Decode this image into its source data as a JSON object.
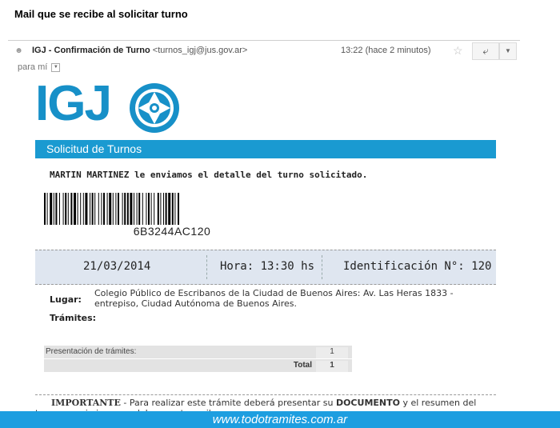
{
  "page": {
    "heading": "Mail que se recibe al solicitar turno"
  },
  "email": {
    "sender_name": "IGJ - Confirmación de Turno",
    "sender_email": "<turnos_igj@jus.gov.ar>",
    "time": "13:22 (hace 2 minutos)",
    "recipient": "para mí",
    "icons": {
      "avatar": "person-icon",
      "star": "star-icon",
      "reply": "reply-icon",
      "more": "chevron-down-icon",
      "recipient_dropdown": "chevron-down-icon"
    }
  },
  "logo": {
    "text": "IGJ",
    "color": "#1790c8"
  },
  "banner": {
    "title": "Solicitud de Turnos",
    "color": "#1a9ad1"
  },
  "body": {
    "intro": "MARTIN MARTINEZ le enviamos el detalle del turno solicitado.",
    "barcode_text": "6B3244AC120",
    "date": "21/03/2014",
    "hora": "Hora: 13:30 hs",
    "identificacion": "Identificación N°: 120",
    "lugar_label": "Lugar:",
    "lugar_value": "Colegio Público de Escribanos de la Ciudad de Buenos Aires: Av. Las Heras 1833 - entrepiso, Ciudad Autónoma de Buenos Aires.",
    "tramites_label": "Trámites:",
    "table": {
      "rows": [
        {
          "name": "Presentación de trámites:",
          "qty": "1"
        }
      ],
      "total_label": "Total",
      "total_value": "1"
    },
    "importante_label": "IMPORTANTE",
    "importante_text_1": " - Para realizar este trámite deberá presentar su ",
    "importante_doc": "DOCUMENTO",
    "importante_text_2": " y el resumen del turno o copia impresa del presente mail."
  },
  "footer": {
    "url": "www.todotramites.com.ar",
    "color": "#1d9ee0"
  }
}
